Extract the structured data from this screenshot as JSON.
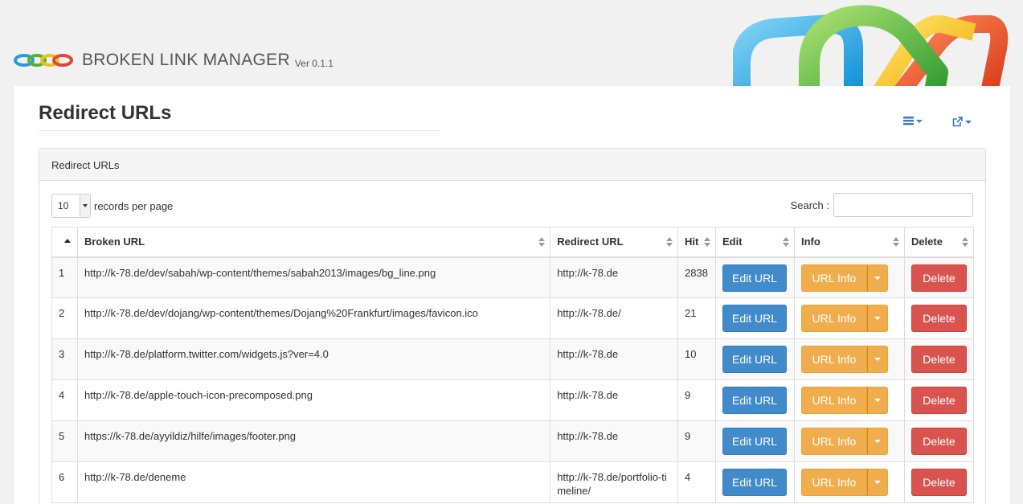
{
  "header": {
    "app_title": "BROKEN LINK MANAGER",
    "version": "Ver 0.1.1"
  },
  "page": {
    "title": "Redirect URLs",
    "panel_title": "Redirect URLs"
  },
  "toolbar": {
    "icons": [
      "list-menu-icon",
      "external-link-icon"
    ]
  },
  "table_controls": {
    "page_length": "10",
    "records_label": "records per page",
    "search_label": "Search :",
    "search_value": ""
  },
  "table": {
    "columns": [
      "",
      "Broken URL",
      "Redirect URL",
      "Hit",
      "Edit",
      "Info",
      "Delete"
    ],
    "rows": [
      {
        "id": "1",
        "broken": "http://k-78.de/dev/sabah/wp-content/themes/sabah2013/images/bg_line.png",
        "redirect": "http://k-78.de",
        "hit": "2838"
      },
      {
        "id": "2",
        "broken": "http://k-78.de/dev/dojang/wp-content/themes/Dojang%20Frankfurt/images/favicon.ico",
        "redirect": "http://k-78.de/",
        "hit": "21"
      },
      {
        "id": "3",
        "broken": "http://k-78.de/platform.twitter.com/widgets.js?ver=4.0",
        "redirect": "http://k-78.de",
        "hit": "10"
      },
      {
        "id": "4",
        "broken": "http://k-78.de/apple-touch-icon-precomposed.png",
        "redirect": "http://k-78.de",
        "hit": "9"
      },
      {
        "id": "5",
        "broken": "https://k-78.de/ayyildiz/hilfe/images/footer.png",
        "redirect": "http://k-78.de",
        "hit": "9"
      },
      {
        "id": "6",
        "broken": "http://k-78.de/deneme",
        "redirect": "http://k-78.de/portfolio-timeline/",
        "hit": "4"
      }
    ],
    "edit_label": "Edit URL",
    "info_label": "URL Info",
    "delete_label": "Delete"
  },
  "colors": {
    "primary": "#428bca",
    "warning": "#f0ad4e",
    "danger": "#d9534f"
  }
}
